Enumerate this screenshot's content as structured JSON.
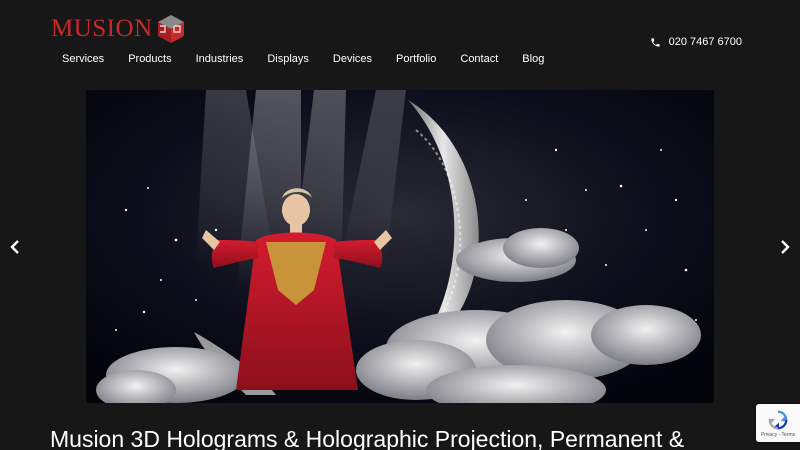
{
  "brand": {
    "logo_text": "MUSION",
    "accent": "#c8292b"
  },
  "header": {
    "phone": "020 7467 6700",
    "phone_icon": "phone-icon"
  },
  "nav": {
    "items": [
      {
        "label": "Services"
      },
      {
        "label": "Products"
      },
      {
        "label": "Industries"
      },
      {
        "label": "Displays"
      },
      {
        "label": "Devices"
      },
      {
        "label": "Portfolio"
      },
      {
        "label": "Contact"
      },
      {
        "label": "Blog"
      }
    ]
  },
  "hero": {
    "prev_icon": "chevron-left-icon",
    "next_icon": "chevron-right-icon"
  },
  "main": {
    "headline": "Musion 3D Holograms & Holographic Projection, Permanent &"
  },
  "recaptcha": {
    "links": "Privacy - Terms"
  },
  "colors": {
    "background": "#171717",
    "text": "#ffffff"
  }
}
